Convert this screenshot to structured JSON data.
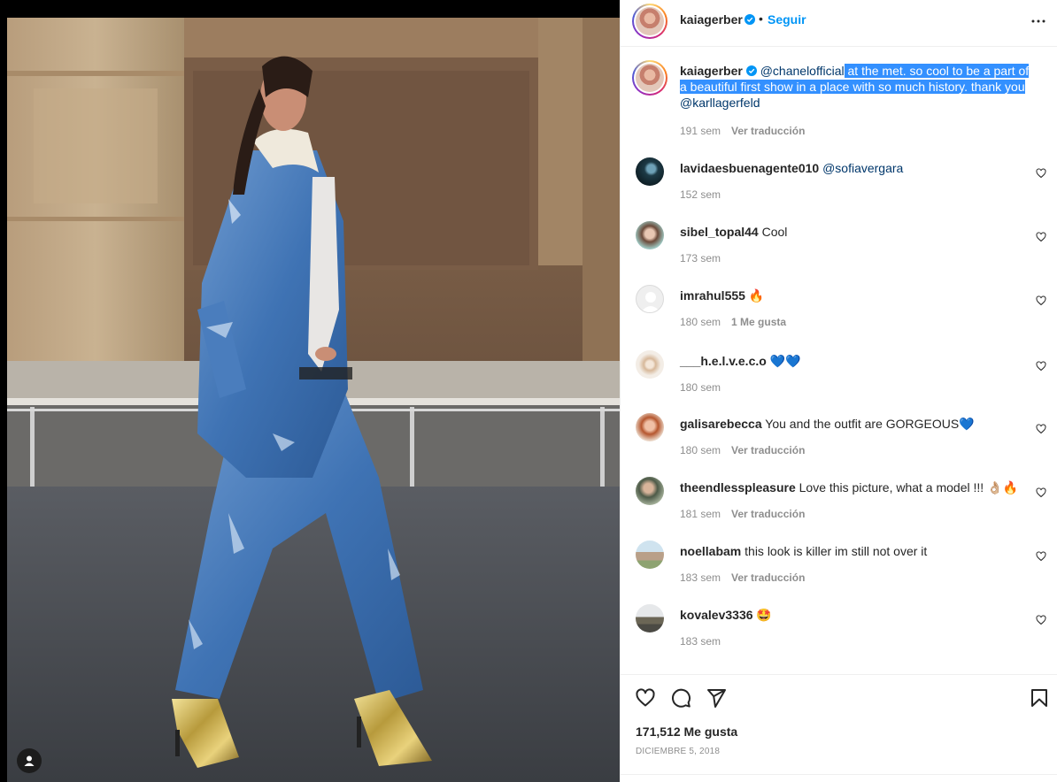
{
  "post": {
    "author": "kaiagerber",
    "verified": true,
    "follow_label": "Seguir",
    "separator": "•"
  },
  "caption": {
    "username": "kaiagerber",
    "mention_1": "@chanelofficial",
    "text_1": " at the met. so cool to be a part of a beautiful first show in a place with so much history. thank you ",
    "mention_2": "@karllagerfeld",
    "time": "191 sem",
    "translate": "Ver traducción"
  },
  "comments": [
    {
      "username": "lavidaesbuenagente010",
      "text": "",
      "mention": "@sofiavergara",
      "time": "152 sem",
      "extra": ""
    },
    {
      "username": "sibel_topal44",
      "text": "Cool",
      "mention": "",
      "time": "173 sem",
      "extra": ""
    },
    {
      "username": "imrahul555",
      "text": "🔥",
      "mention": "",
      "time": "180 sem",
      "extra": "1 Me gusta"
    },
    {
      "username": "___h.e.l.v.e.c.o",
      "text": "💙💙",
      "mention": "",
      "time": "180 sem",
      "extra": ""
    },
    {
      "username": "galisarebecca",
      "text": "You and the outfit are GORGEOUS💙",
      "mention": "",
      "time": "180 sem",
      "extra": "Ver traducción"
    },
    {
      "username": "theendlesspleasure",
      "text": "Love this picture, what a model !!! 👌🏼🔥",
      "mention": "",
      "time": "181 sem",
      "extra": "Ver traducción"
    },
    {
      "username": "noellabam",
      "text": "this look is killer im still not over it",
      "mention": "",
      "time": "183 sem",
      "extra": "Ver traducción"
    },
    {
      "username": "kovalev3336",
      "text": "🤩",
      "mention": "",
      "time": "183 sem",
      "extra": ""
    }
  ],
  "actions": {
    "icons": [
      "heart-icon",
      "comment-icon",
      "share-icon",
      "bookmark-icon"
    ],
    "likes": "171,512 Me gusta",
    "date": "DICIEMBRE 5, 2018"
  },
  "colors": {
    "link_blue": "#0095f6",
    "mention_blue": "#00376b",
    "selection": "#3390ff",
    "muted": "#8e8e8e",
    "text": "#262626"
  }
}
